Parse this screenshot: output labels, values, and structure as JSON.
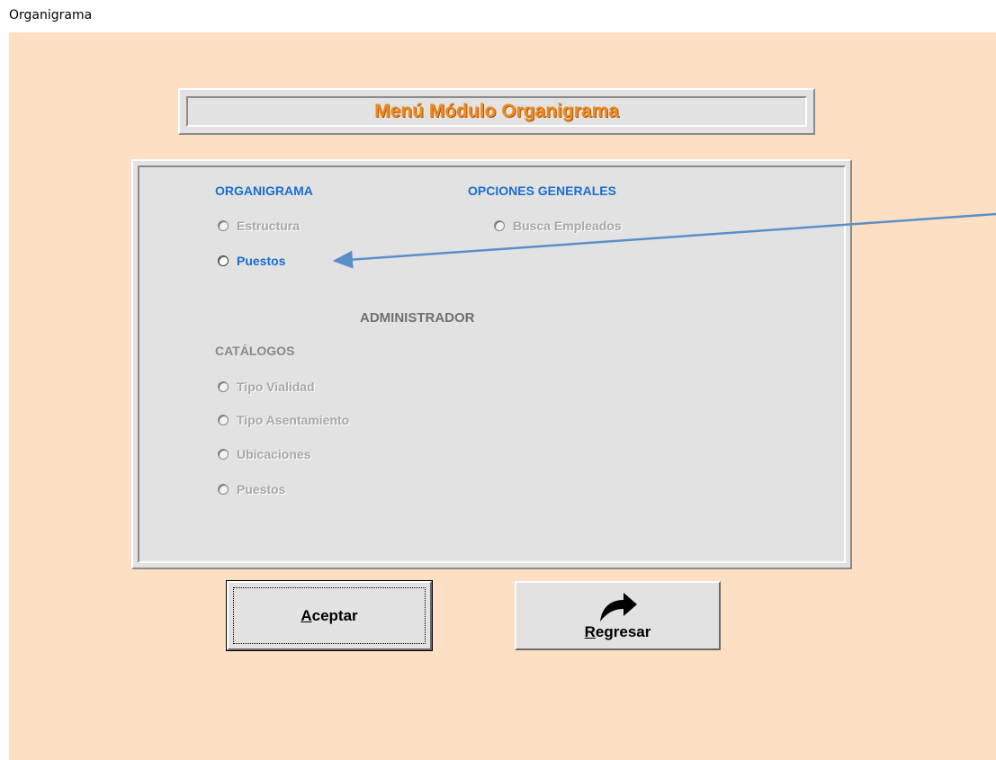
{
  "window": {
    "title": "Organigrama"
  },
  "header": {
    "title": "Menú Módulo Organigrama"
  },
  "sections": {
    "organigrama": {
      "label": "ORGANIGRAMA",
      "options": [
        {
          "label": "Estructura",
          "enabled": false
        },
        {
          "label": "Puestos",
          "enabled": true
        }
      ]
    },
    "generales": {
      "label": "OPCIONES GENERALES",
      "options": [
        {
          "label": "Busca Empleados",
          "enabled": false
        }
      ]
    },
    "administrador": {
      "label": "ADMINISTRADOR",
      "catalogos_label": "CATÁLOGOS",
      "options": [
        {
          "label": "Tipo Vialidad",
          "enabled": false
        },
        {
          "label": "Tipo Asentamiento",
          "enabled": false
        },
        {
          "label": "Ubicaciones",
          "enabled": false
        },
        {
          "label": "Puestos",
          "enabled": false
        }
      ]
    }
  },
  "buttons": {
    "accept": {
      "mnemonic": "A",
      "rest": "ceptar"
    },
    "back": {
      "mnemonic": "R",
      "rest": "egresar",
      "icon": "curved-arrow-icon"
    }
  },
  "colors": {
    "background": "#fde0c3",
    "title": "#f08a1c",
    "section": "#1a6ecd",
    "annotation_arrow": "#5b8fc9"
  }
}
